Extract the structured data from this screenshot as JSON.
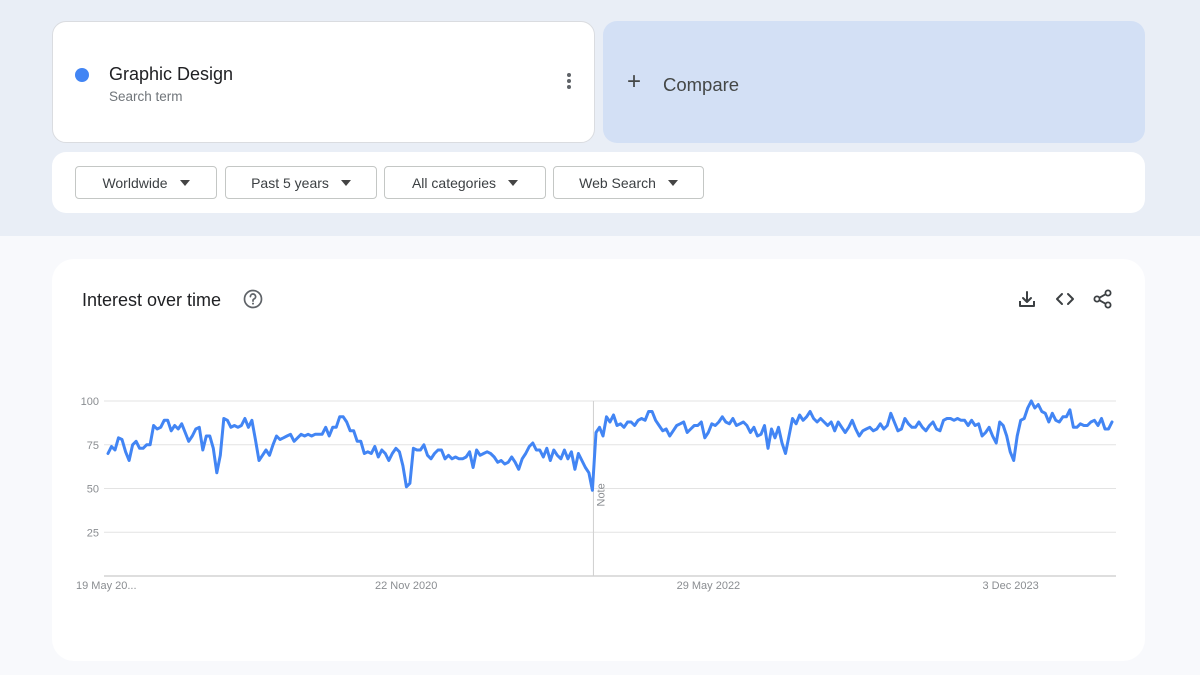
{
  "search_term": {
    "name": "Graphic Design",
    "subtitle": "Search term",
    "color": "#4285f4",
    "menu_icon": "more-vert-icon"
  },
  "compare": {
    "icon": "plus-icon",
    "label": "Compare"
  },
  "filters": [
    {
      "label": "Worldwide"
    },
    {
      "label": "Past 5 years"
    },
    {
      "label": "All categories"
    },
    {
      "label": "Web Search"
    }
  ],
  "panel": {
    "title": "Interest over time",
    "help_icon": "help-icon",
    "tools": [
      "download-icon",
      "embed-code-icon",
      "share-icon"
    ]
  },
  "chart_data": {
    "type": "line",
    "ylim": [
      0,
      100
    ],
    "y_ticks": [
      "25",
      "50",
      "75",
      "100"
    ],
    "x_tick_labels": [
      "19 May 20...",
      "22 Nov 2020",
      "29 May 2022",
      "3 Dec 2023"
    ],
    "note_label": "Note",
    "note_index": 138,
    "line_color": "#4285f4",
    "series": [
      {
        "values": [
          70,
          74,
          72,
          79,
          78,
          71,
          66,
          75,
          77,
          73,
          73,
          75,
          75,
          86,
          84,
          85,
          89,
          89,
          83,
          86,
          84,
          87,
          82,
          77,
          80,
          84,
          85,
          72,
          80,
          80,
          73,
          59,
          69,
          90,
          89,
          85,
          86,
          85,
          86,
          90,
          85,
          89,
          78,
          66,
          69,
          72,
          69,
          75,
          80,
          78,
          79,
          80,
          81,
          77,
          79,
          81,
          80,
          81,
          80,
          81,
          81,
          81,
          85,
          80,
          85,
          85,
          91,
          91,
          88,
          83,
          83,
          77,
          77,
          70,
          71,
          70,
          74,
          68,
          72,
          70,
          66,
          70,
          73,
          71,
          63,
          51,
          53,
          73,
          72,
          72,
          75,
          69,
          67,
          70,
          72,
          72,
          67,
          69,
          67,
          68,
          67,
          67,
          68,
          71,
          62,
          72,
          69,
          70,
          71,
          70,
          68,
          65,
          66,
          64,
          65,
          68,
          65,
          61,
          67,
          70,
          74,
          76,
          72,
          72,
          68,
          73,
          66,
          72,
          69,
          67,
          72,
          67,
          71,
          61,
          70,
          66,
          62,
          59,
          49,
          82,
          85,
          80,
          91,
          88,
          92,
          86,
          87,
          85,
          88,
          88,
          86,
          89,
          90,
          89,
          94,
          94,
          89,
          86,
          83,
          84,
          80,
          83,
          86,
          87,
          88,
          82,
          84,
          86,
          86,
          88,
          79,
          82,
          87,
          86,
          88,
          91,
          88,
          87,
          90,
          86,
          87,
          88,
          86,
          82,
          85,
          80,
          81,
          86,
          73,
          84,
          79,
          85,
          76,
          70,
          80,
          90,
          87,
          92,
          89,
          91,
          94,
          90,
          88,
          90,
          88,
          86,
          88,
          83,
          88,
          85,
          82,
          85,
          89,
          84,
          80,
          83,
          84,
          85,
          83,
          84,
          87,
          84,
          86,
          93,
          88,
          83,
          84,
          90,
          87,
          85,
          85,
          88,
          85,
          83,
          86,
          88,
          84,
          83,
          89,
          90,
          90,
          89,
          90,
          89,
          89,
          86,
          89,
          86,
          87,
          80,
          82,
          85,
          80,
          76,
          88,
          86,
          80,
          71,
          66,
          80,
          89,
          90,
          96,
          100,
          96,
          98,
          94,
          93,
          88,
          93,
          89,
          88,
          91,
          91,
          95,
          85,
          85,
          87,
          86,
          86,
          88,
          89,
          86,
          90,
          84,
          84,
          88
        ]
      }
    ]
  }
}
